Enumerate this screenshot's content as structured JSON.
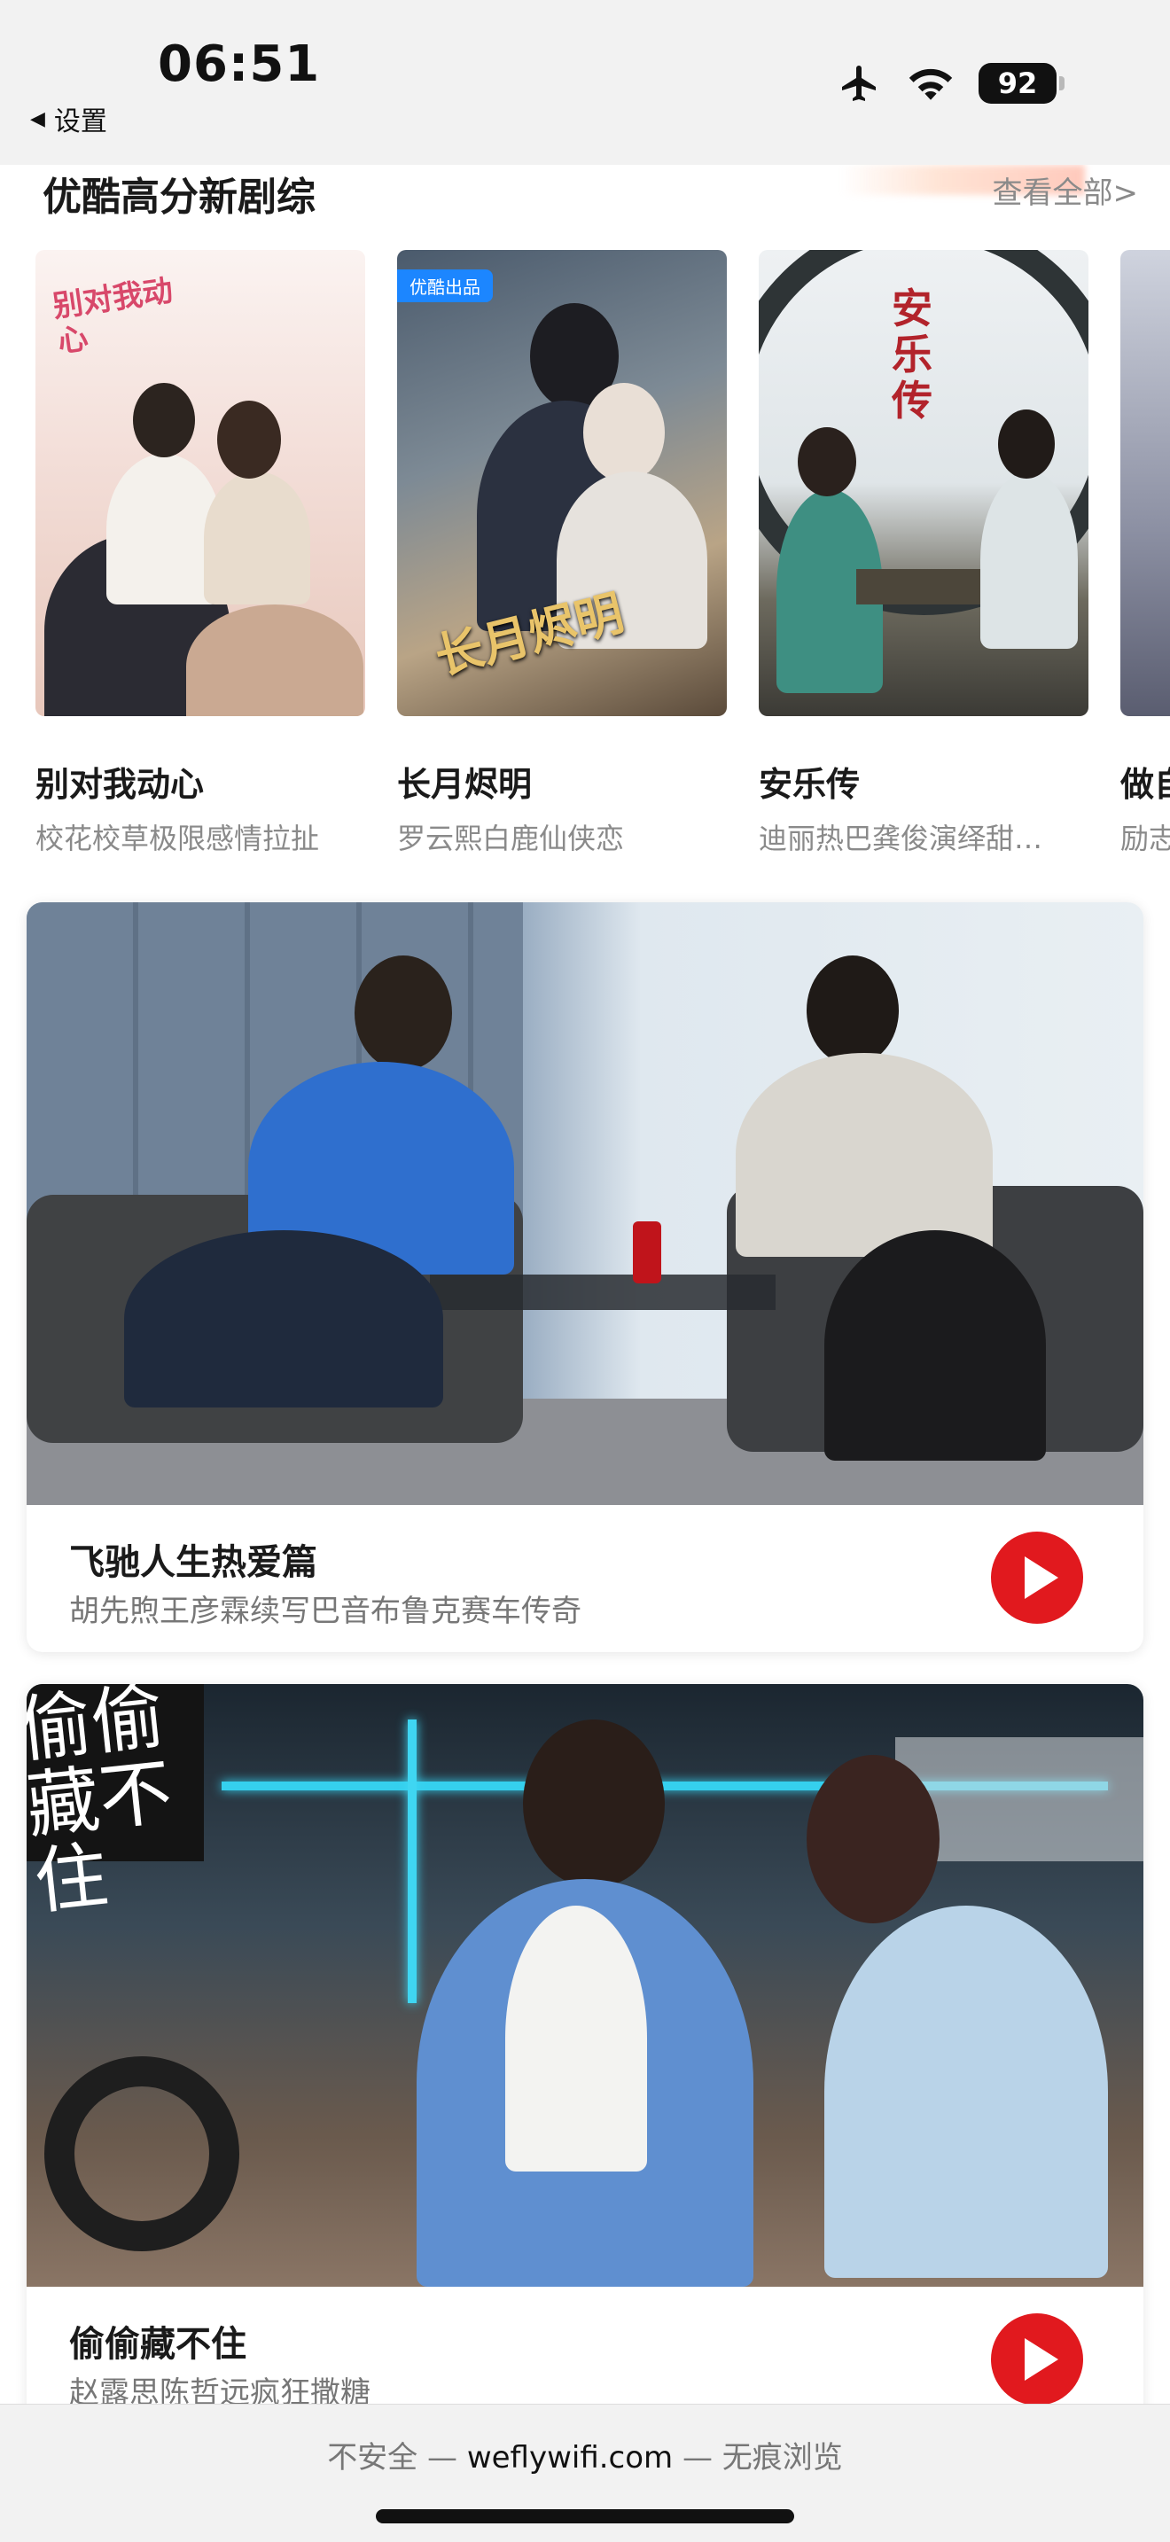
{
  "status_bar": {
    "time": "06:51",
    "back_label": "设置",
    "battery": "92",
    "icons": [
      "airplane-icon",
      "wifi-icon",
      "battery-icon"
    ]
  },
  "section": {
    "title": "优酷高分新剧综",
    "view_all": "查看全部>"
  },
  "shows": [
    {
      "title": "别对我动心",
      "desc": "校花校草极限感情拉扯",
      "poster_text": "别对我动心"
    },
    {
      "title": "长月烬明",
      "desc": "罗云熙白鹿仙侠恋",
      "poster_text": "长月烬明",
      "badge": "优酷出品"
    },
    {
      "title": "安乐传",
      "desc": "迪丽热巴龚俊演绎甜…",
      "poster_text": "安乐传"
    },
    {
      "title": "做自",
      "desc": "励志"
    }
  ],
  "features": [
    {
      "title": "飞驰人生热爱篇",
      "desc": "胡先煦王彦霖续写巴音布鲁克赛车传奇"
    },
    {
      "title": "偷偷藏不住",
      "desc": "赵露思陈哲远疯狂撒糖",
      "poster_text": "偷偷藏不住"
    }
  ],
  "url_bar": {
    "security": "不安全",
    "separator": "—",
    "domain": "weflywifi.com",
    "mode": "无痕浏览"
  },
  "colors": {
    "accent_red": "#e1191e",
    "badge_blue": "#1c86ff",
    "secondary_text": "#8a8a8a"
  }
}
